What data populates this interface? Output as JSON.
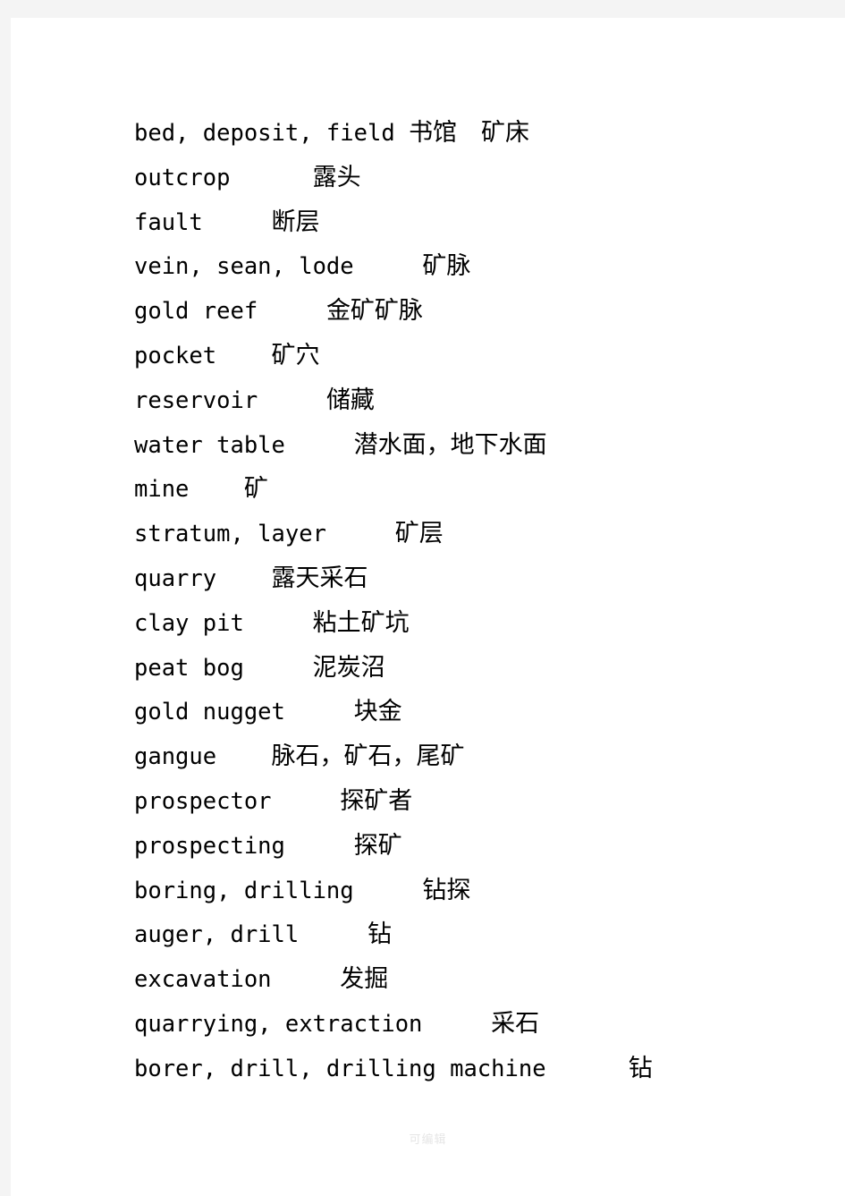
{
  "page": {
    "background_color": "#f4f4f4",
    "paper_color": "#ffffff",
    "text_color": "#000000"
  },
  "watermark": {
    "text": "可编辑",
    "color": "#e6e6e6"
  },
  "glossary": {
    "entries": [
      {
        "en": "bed, deposit, field",
        "gap": " ",
        "zh": "书馆　矿床"
      },
      {
        "en": "outcrop",
        "gap": "      ",
        "zh": "露头"
      },
      {
        "en": "fault",
        "gap": "     ",
        "zh": "断层"
      },
      {
        "en": "vein, sean, lode",
        "gap": "     ",
        "zh": "矿脉"
      },
      {
        "en": "gold reef",
        "gap": "     ",
        "zh": "金矿矿脉"
      },
      {
        "en": "pocket",
        "gap": "    ",
        "zh": "矿穴"
      },
      {
        "en": "reservoir",
        "gap": "     ",
        "zh": "储藏"
      },
      {
        "en": "water table",
        "gap": "     ",
        "zh": "潜水面，地下水面"
      },
      {
        "en": "mine",
        "gap": "    ",
        "zh": "矿"
      },
      {
        "en": "stratum, layer",
        "gap": "     ",
        "zh": "矿层"
      },
      {
        "en": "quarry",
        "gap": "    ",
        "zh": "露天采石"
      },
      {
        "en": "clay pit",
        "gap": "     ",
        "zh": "粘土矿坑"
      },
      {
        "en": "peat bog",
        "gap": "     ",
        "zh": "泥炭沼"
      },
      {
        "en": "gold nugget",
        "gap": "     ",
        "zh": "块金"
      },
      {
        "en": "gangue",
        "gap": "    ",
        "zh": "脉石，矿石，尾矿"
      },
      {
        "en": "prospector",
        "gap": "     ",
        "zh": "探矿者"
      },
      {
        "en": "prospecting",
        "gap": "     ",
        "zh": "探矿"
      },
      {
        "en": "boring, drilling",
        "gap": "     ",
        "zh": "钻探"
      },
      {
        "en": "auger, drill",
        "gap": "     ",
        "zh": "钻"
      },
      {
        "en": "excavation",
        "gap": "     ",
        "zh": "发掘"
      },
      {
        "en": "quarrying, extraction",
        "gap": "     ",
        "zh": "采石"
      },
      {
        "en": "borer, drill, drilling machine",
        "gap": "      ",
        "zh": "钻"
      }
    ]
  }
}
